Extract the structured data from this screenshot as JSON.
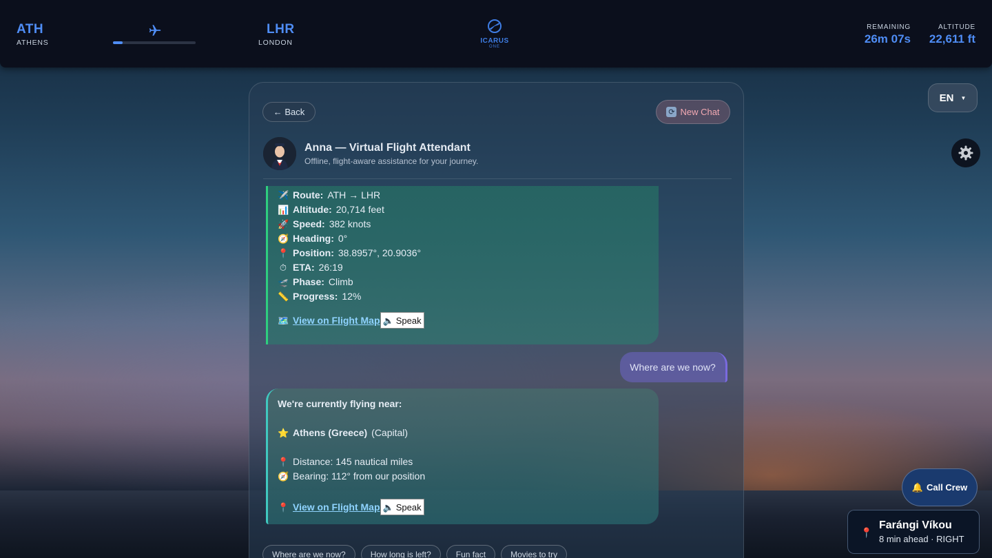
{
  "header": {
    "origin": {
      "code": "ATH",
      "name": "ATHENS"
    },
    "destination": {
      "code": "LHR",
      "name": "LONDON"
    },
    "route_progress_fraction": 0.12,
    "logo": {
      "name": "ICARUS",
      "sub": "ONE"
    },
    "remaining": {
      "label": "REMAINING",
      "value": "26m 07s"
    },
    "altitude": {
      "label": "ALTITUDE",
      "value": "22,611 ft"
    }
  },
  "controls": {
    "language": "EN",
    "settings_icon": "gear-icon"
  },
  "chat": {
    "back_label": "← Back",
    "new_chat_label": "New Chat",
    "agent_name": "Anna — Virtual Flight Attendant",
    "agent_subtitle": "Offline, flight-aware assistance for your journey.",
    "flight_info": [
      {
        "icon": "✈️",
        "label": "Route:",
        "value": "ATH → LHR"
      },
      {
        "icon": "📊",
        "label": "Altitude:",
        "value": "20,714 feet"
      },
      {
        "icon": "🚀",
        "label": "Speed:",
        "value": "382 knots"
      },
      {
        "icon": "🧭",
        "label": "Heading:",
        "value": "0°"
      },
      {
        "icon": "📍",
        "label": "Position:",
        "value": "38.8957°, 20.9036°"
      },
      {
        "icon": "⏱",
        "label": "ETA:",
        "value": "26:19"
      },
      {
        "icon": "🛫",
        "label": "Phase:",
        "value": "Climb"
      },
      {
        "icon": "📏",
        "label": "Progress:",
        "value": "12%"
      }
    ],
    "map_link_label": "View on Flight Map",
    "map_link_icon_1": "🗺️",
    "map_link_icon_2": "📍",
    "speak_label": "Speak",
    "speak_icon": "🔈",
    "user_message": "Where are we now?",
    "reply": {
      "heading": "We're currently flying near:",
      "place_icon": "⭐",
      "place_bold": "Athens (Greece)",
      "place_note": "(Capital)",
      "distance": "Distance: 145 nautical miles",
      "bearing": "Bearing: 112° from our position"
    },
    "suggestions": [
      "Where are we now?",
      "How long is left?",
      "Fun fact",
      "Movies to try"
    ]
  },
  "call_crew_label": "Call Crew",
  "call_crew_icon": "🔔",
  "poi": {
    "name": "Farángi Víkou",
    "subtitle": "8 min ahead · RIGHT"
  },
  "colors": {
    "accent": "#4f8df5",
    "bubble_border": "#2ecf7f",
    "link": "#8fd3ff"
  }
}
